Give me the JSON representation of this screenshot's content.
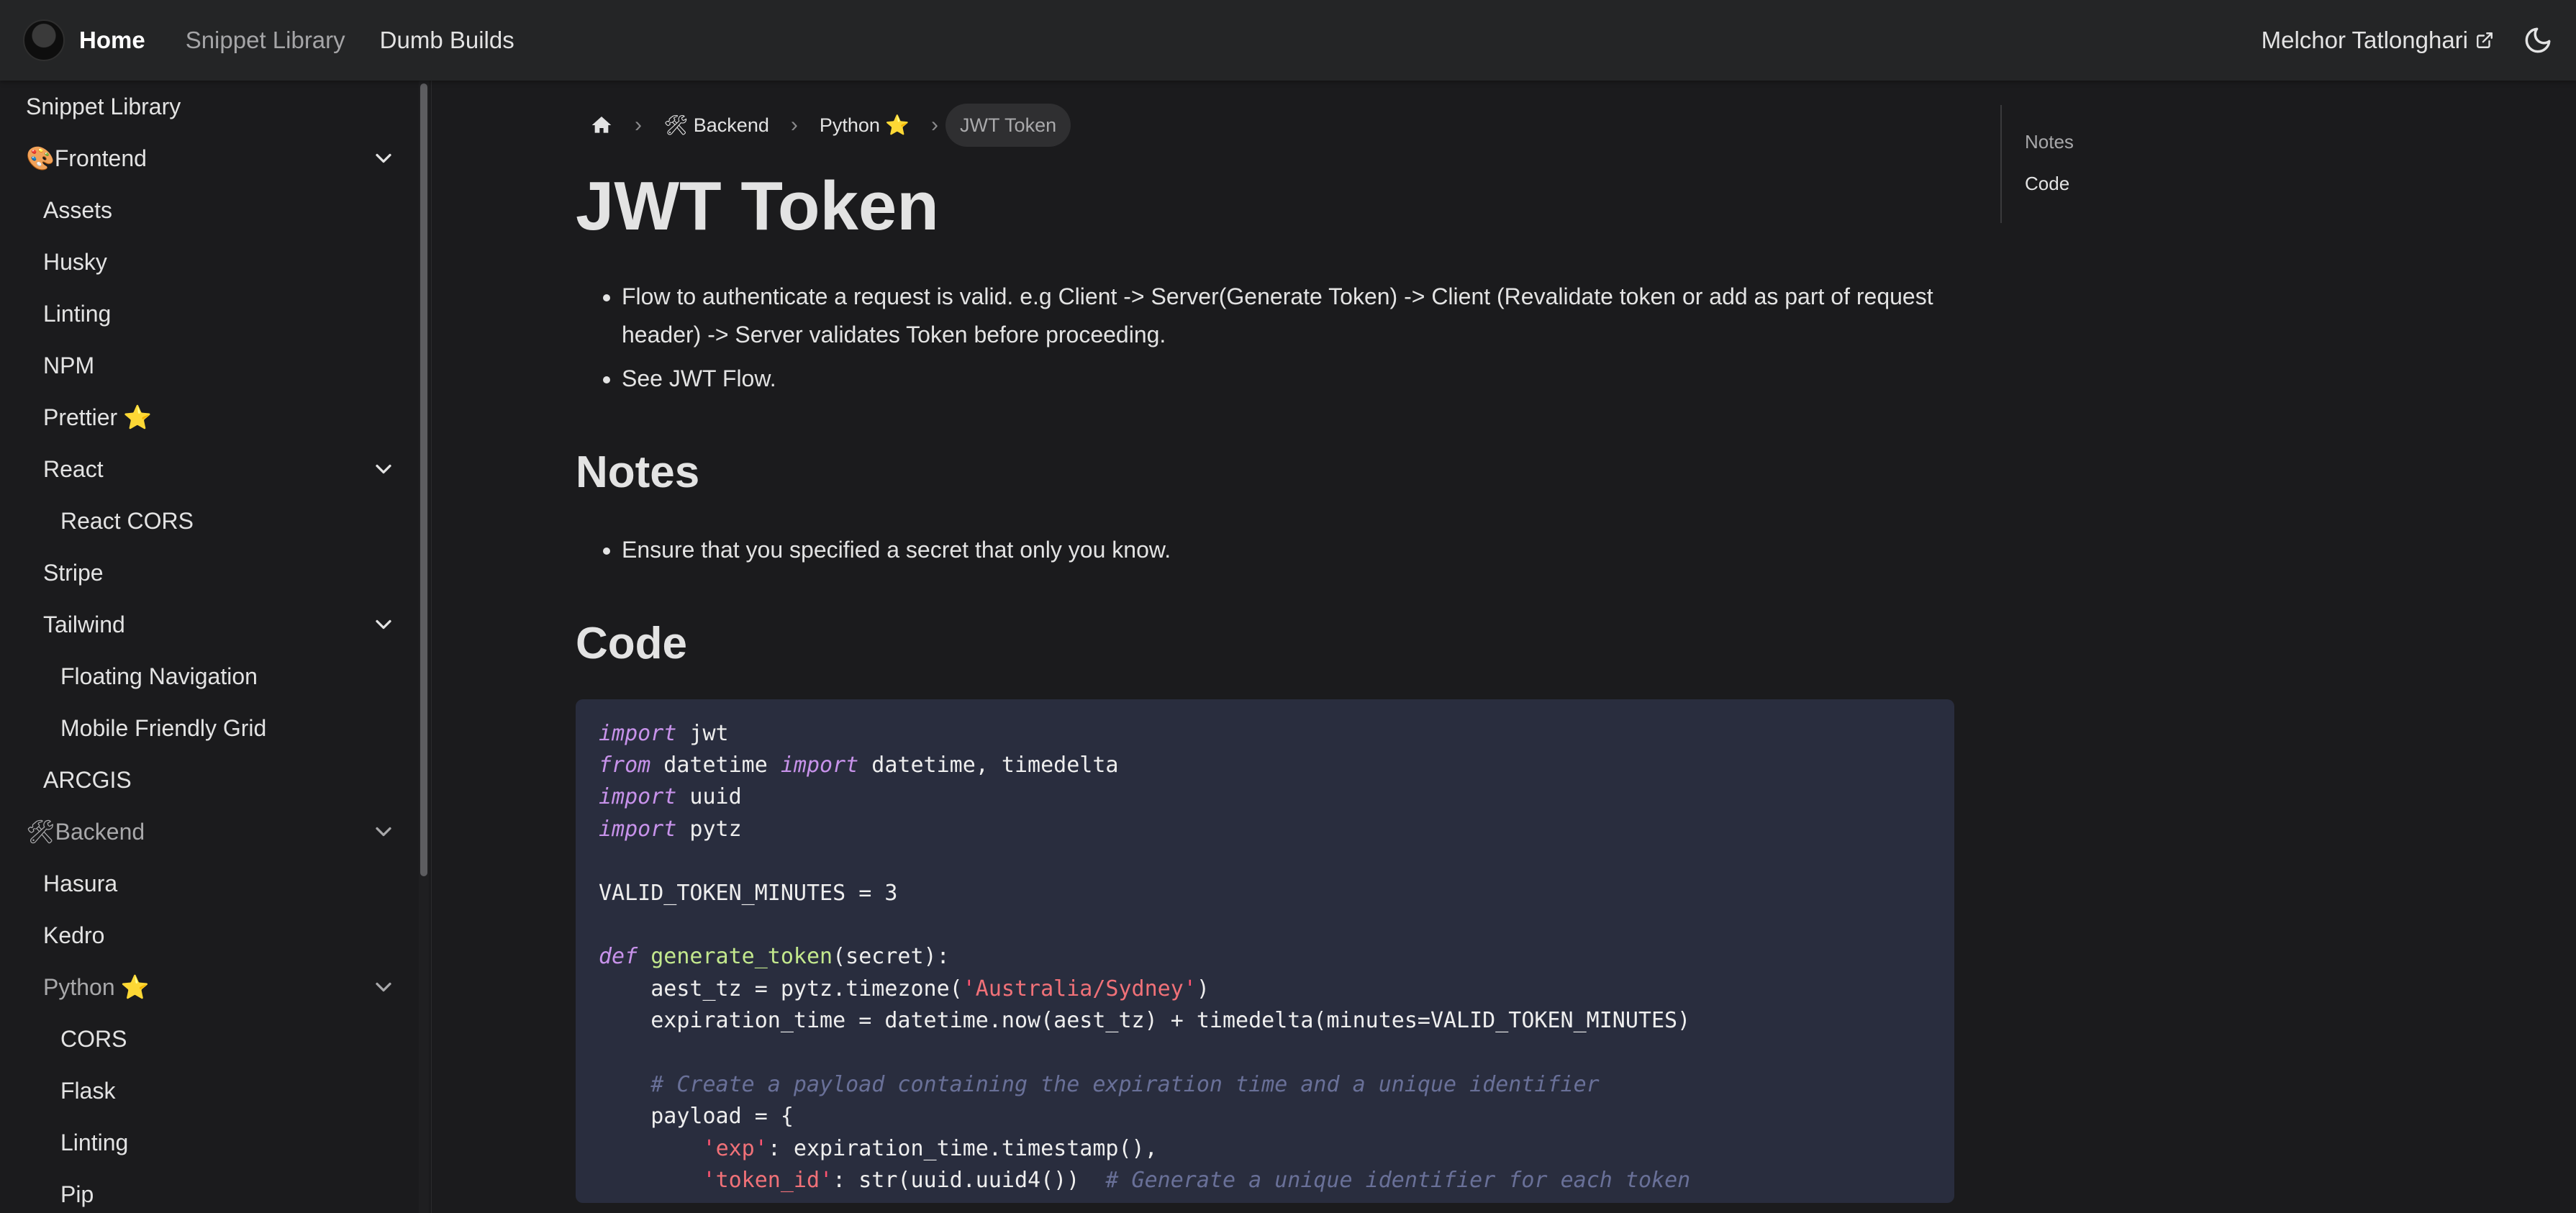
{
  "navbar": {
    "brand": "Home",
    "links": [
      "Snippet Library",
      "Dumb Builds"
    ],
    "author": "Melchor Tatlonghari",
    "icons": [
      "avatar",
      "external-link-icon",
      "moon-icon"
    ]
  },
  "sidebar": {
    "items": [
      {
        "label": "Snippet Library",
        "level": 0
      },
      {
        "label": "Frontend",
        "emoji": "🎨",
        "level": 0,
        "collapsible": true
      },
      {
        "label": "Assets",
        "level": 1
      },
      {
        "label": "Husky",
        "level": 1
      },
      {
        "label": "Linting",
        "level": 1
      },
      {
        "label": "NPM",
        "level": 1
      },
      {
        "label": "Prettier",
        "star": "⭐",
        "level": 1
      },
      {
        "label": "React",
        "level": 1,
        "collapsible": true
      },
      {
        "label": "React CORS",
        "level": 2
      },
      {
        "label": "Stripe",
        "level": 1
      },
      {
        "label": "Tailwind",
        "level": 1,
        "collapsible": true
      },
      {
        "label": "Floating Navigation",
        "level": 2
      },
      {
        "label": "Mobile Friendly Grid",
        "level": 2
      },
      {
        "label": "ARCGIS",
        "level": 1
      },
      {
        "label": "Backend",
        "emoji": "🛠",
        "level": 0,
        "collapsible": true
      },
      {
        "label": "Hasura",
        "level": 1
      },
      {
        "label": "Kedro",
        "level": 1
      },
      {
        "label": "Python",
        "star": "⭐",
        "level": 1,
        "collapsible": true
      },
      {
        "label": "CORS",
        "level": 2
      },
      {
        "label": "Flask",
        "level": 2
      },
      {
        "label": "Linting",
        "level": 2
      },
      {
        "label": "Pip",
        "level": 2
      }
    ]
  },
  "breadcrumbs": {
    "home_icon": "home-icon",
    "items": [
      "🛠 Backend",
      "Python ⭐",
      "JWT Token"
    ]
  },
  "page": {
    "title": "JWT Token",
    "intro": [
      "Flow to authenticate a request is valid. e.g Client -> Server(Generate Token) -> Client (Revalidate token or add as part of request header) -> Server validates Token before proceeding.",
      "See JWT Flow."
    ],
    "notes_heading": "Notes",
    "notes": [
      "Ensure that you specified a secret that only you know."
    ],
    "code_heading": "Code"
  },
  "code": {
    "lines": [
      "import jwt",
      "from datetime import datetime, timedelta",
      "import uuid",
      "import pytz",
      "",
      "VALID_TOKEN_MINUTES = 3",
      "",
      "def generate_token(secret):",
      "    aest_tz = pytz.timezone('Australia/Sydney')",
      "    expiration_time = datetime.now(aest_tz) + timedelta(minutes=VALID_TOKEN_MINUTES)",
      "",
      "    # Create a payload containing the expiration time and a unique identifier",
      "    payload = {",
      "        'exp': expiration_time.timestamp(),",
      "        'token_id': str(uuid.uuid4())  # Generate a unique identifier for each token"
    ]
  },
  "toc": {
    "items": [
      "Notes",
      "Code"
    ]
  },
  "colors": {
    "background": "#1b1b1d",
    "navbar": "#242526",
    "code_bg": "#292d3e",
    "keyword": "#c792ea",
    "function": "#c3e88d",
    "string": "#f07178",
    "comment": "#697098",
    "star": "#f5c542"
  }
}
